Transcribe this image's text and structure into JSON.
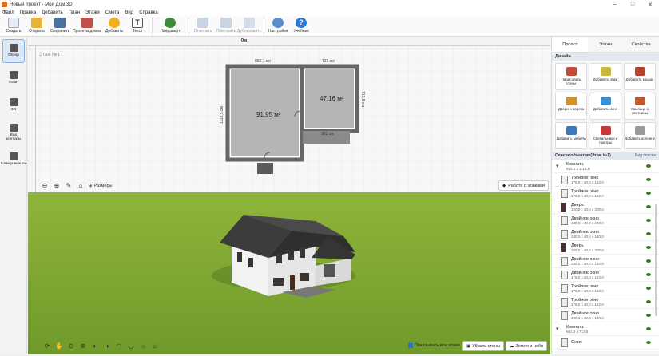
{
  "window": {
    "title": "Новый проект - Мой Дом 3D"
  },
  "menu": [
    "Файл",
    "Правка",
    "Добавить",
    "План",
    "Этажи",
    "Смета",
    "Вид",
    "Справка"
  ],
  "toolbar": {
    "create": "Создать",
    "open": "Открыть",
    "save": "Сохранить",
    "house_projects": "Проекты домов",
    "add": "Добавить",
    "text": "Текст",
    "landscape": "Ландшафт",
    "undo": "Отменить",
    "redo": "Повторить",
    "duplicate": "Дублировать",
    "settings": "Настройки",
    "tutorial": "Учебник"
  },
  "leftbar": [
    {
      "label": "Обзор",
      "icon": "eye-icon"
    },
    {
      "label": "План",
      "icon": "plan-icon"
    },
    {
      "label": "3D",
      "icon": "cube-icon"
    },
    {
      "label": "Вид контуры",
      "icon": "contour-icon"
    },
    {
      "label": "Коммуникации",
      "icon": "pipes-icon"
    }
  ],
  "plan": {
    "floor_label": "Этаж №1",
    "ruler_zero": "0м",
    "dim_top_left": "882,1 см",
    "dim_top_right": "721 см",
    "dim_left": "1118,5 см",
    "dim_right": "713,5 см",
    "dim_small": "361 см",
    "room1_area": "91,95 м²",
    "room2_area": "47,16 м²",
    "sizes_btn": "Размеры",
    "floors_btn": "Работа с этажами"
  },
  "bottombar": {
    "show_all_floors": "Показывать все этажи",
    "hide_walls": "Убрать стены",
    "ground_sky": "Земля и небо"
  },
  "right_tabs": [
    "Проект",
    "Этажи",
    "Свойства"
  ],
  "design": {
    "header": "Дизайн",
    "items": [
      {
        "label": "Нарисовать стены",
        "color": "#c84b3a"
      },
      {
        "label": "Добавить этаж",
        "color": "#c9b63c"
      },
      {
        "label": "Добавить крышу",
        "color": "#b3412f"
      },
      {
        "label": "Двери и ворота",
        "color": "#d49320"
      },
      {
        "label": "Добавить окно",
        "color": "#3a8fd0"
      },
      {
        "label": "Крыльцо и лестницы",
        "color": "#c05a2a"
      },
      {
        "label": "Добавить мебель",
        "color": "#3a78c0"
      },
      {
        "label": "Светильники и люстры",
        "color": "#c03a3a"
      },
      {
        "label": "Добавить колонну",
        "color": "#9a9a9a"
      }
    ]
  },
  "objects": {
    "header": "Список объектов (Этаж №1)",
    "view_list": "Вид списка",
    "items": [
      {
        "type": "room",
        "name": "Комната",
        "dim": "822,1 x 1118,5",
        "indent": false
      },
      {
        "type": "window",
        "name": "Тройное окно",
        "dim": "176,0 x 40,0 x 142,0",
        "indent": true
      },
      {
        "type": "window",
        "name": "Тройное окно",
        "dim": "176,0 x 40,0 x 142,0",
        "indent": true
      },
      {
        "type": "door",
        "name": "Дверь",
        "dim": "100,0 x 40,0 x 200,0",
        "indent": true
      },
      {
        "type": "window",
        "name": "Двойное окно",
        "dim": "130,0 x 40,0 x 140,0",
        "indent": true
      },
      {
        "type": "window",
        "name": "Двойное окно",
        "dim": "130,0 x 40,0 x 140,0",
        "indent": true
      },
      {
        "type": "door",
        "name": "Дверь",
        "dim": "100,0 x 40,0 x 200,0",
        "indent": true
      },
      {
        "type": "window",
        "name": "Двойное окно",
        "dim": "130,0 x 40,0 x 140,0",
        "indent": true
      },
      {
        "type": "window",
        "name": "Двойное окно",
        "dim": "176,0 x 40,0 x 142,0",
        "indent": true
      },
      {
        "type": "window",
        "name": "Тройное окно",
        "dim": "176,0 x 40,0 x 142,0",
        "indent": true
      },
      {
        "type": "window",
        "name": "Тройное окно",
        "dim": "176,0 x 40,0 x 142,0",
        "indent": true
      },
      {
        "type": "window",
        "name": "Двойное окно",
        "dim": "130,0 x 40,0 x 140,0",
        "indent": true
      },
      {
        "type": "room",
        "name": "Комната",
        "dim": "661,0 x 713,5",
        "indent": false
      },
      {
        "type": "window",
        "name": "Окно",
        "dim": "",
        "indent": true
      }
    ]
  }
}
